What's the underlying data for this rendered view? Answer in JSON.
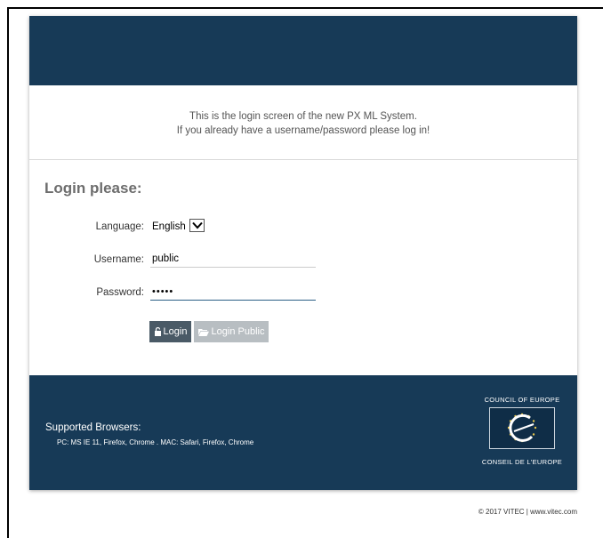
{
  "intro": {
    "line1": "This is the login screen of the new PX ML System.",
    "line2": "If you already have a username/password please log in!"
  },
  "form": {
    "title": "Login please:",
    "language_label": "Language:",
    "language_value": "English",
    "username_label": "Username:",
    "username_value": "public",
    "password_label": "Password:",
    "password_value": "•••••",
    "login_button": "Login",
    "login_public_button": "Login Public"
  },
  "footer": {
    "supported_title": "Supported Browsers:",
    "supported_list": "PC: MS IE 11, Firefox, Chrome . MAC: Safari, Firefox, Chrome",
    "logo_top": "COUNCIL OF EUROPE",
    "logo_bottom": "CONSEIL DE L'EUROPE"
  },
  "copyright": "© 2017 VITEC | www.vitec.com",
  "colors": {
    "header_bg": "#173a57",
    "login_button_bg": "#4a5a66",
    "public_button_bg": "#b8bec2"
  }
}
